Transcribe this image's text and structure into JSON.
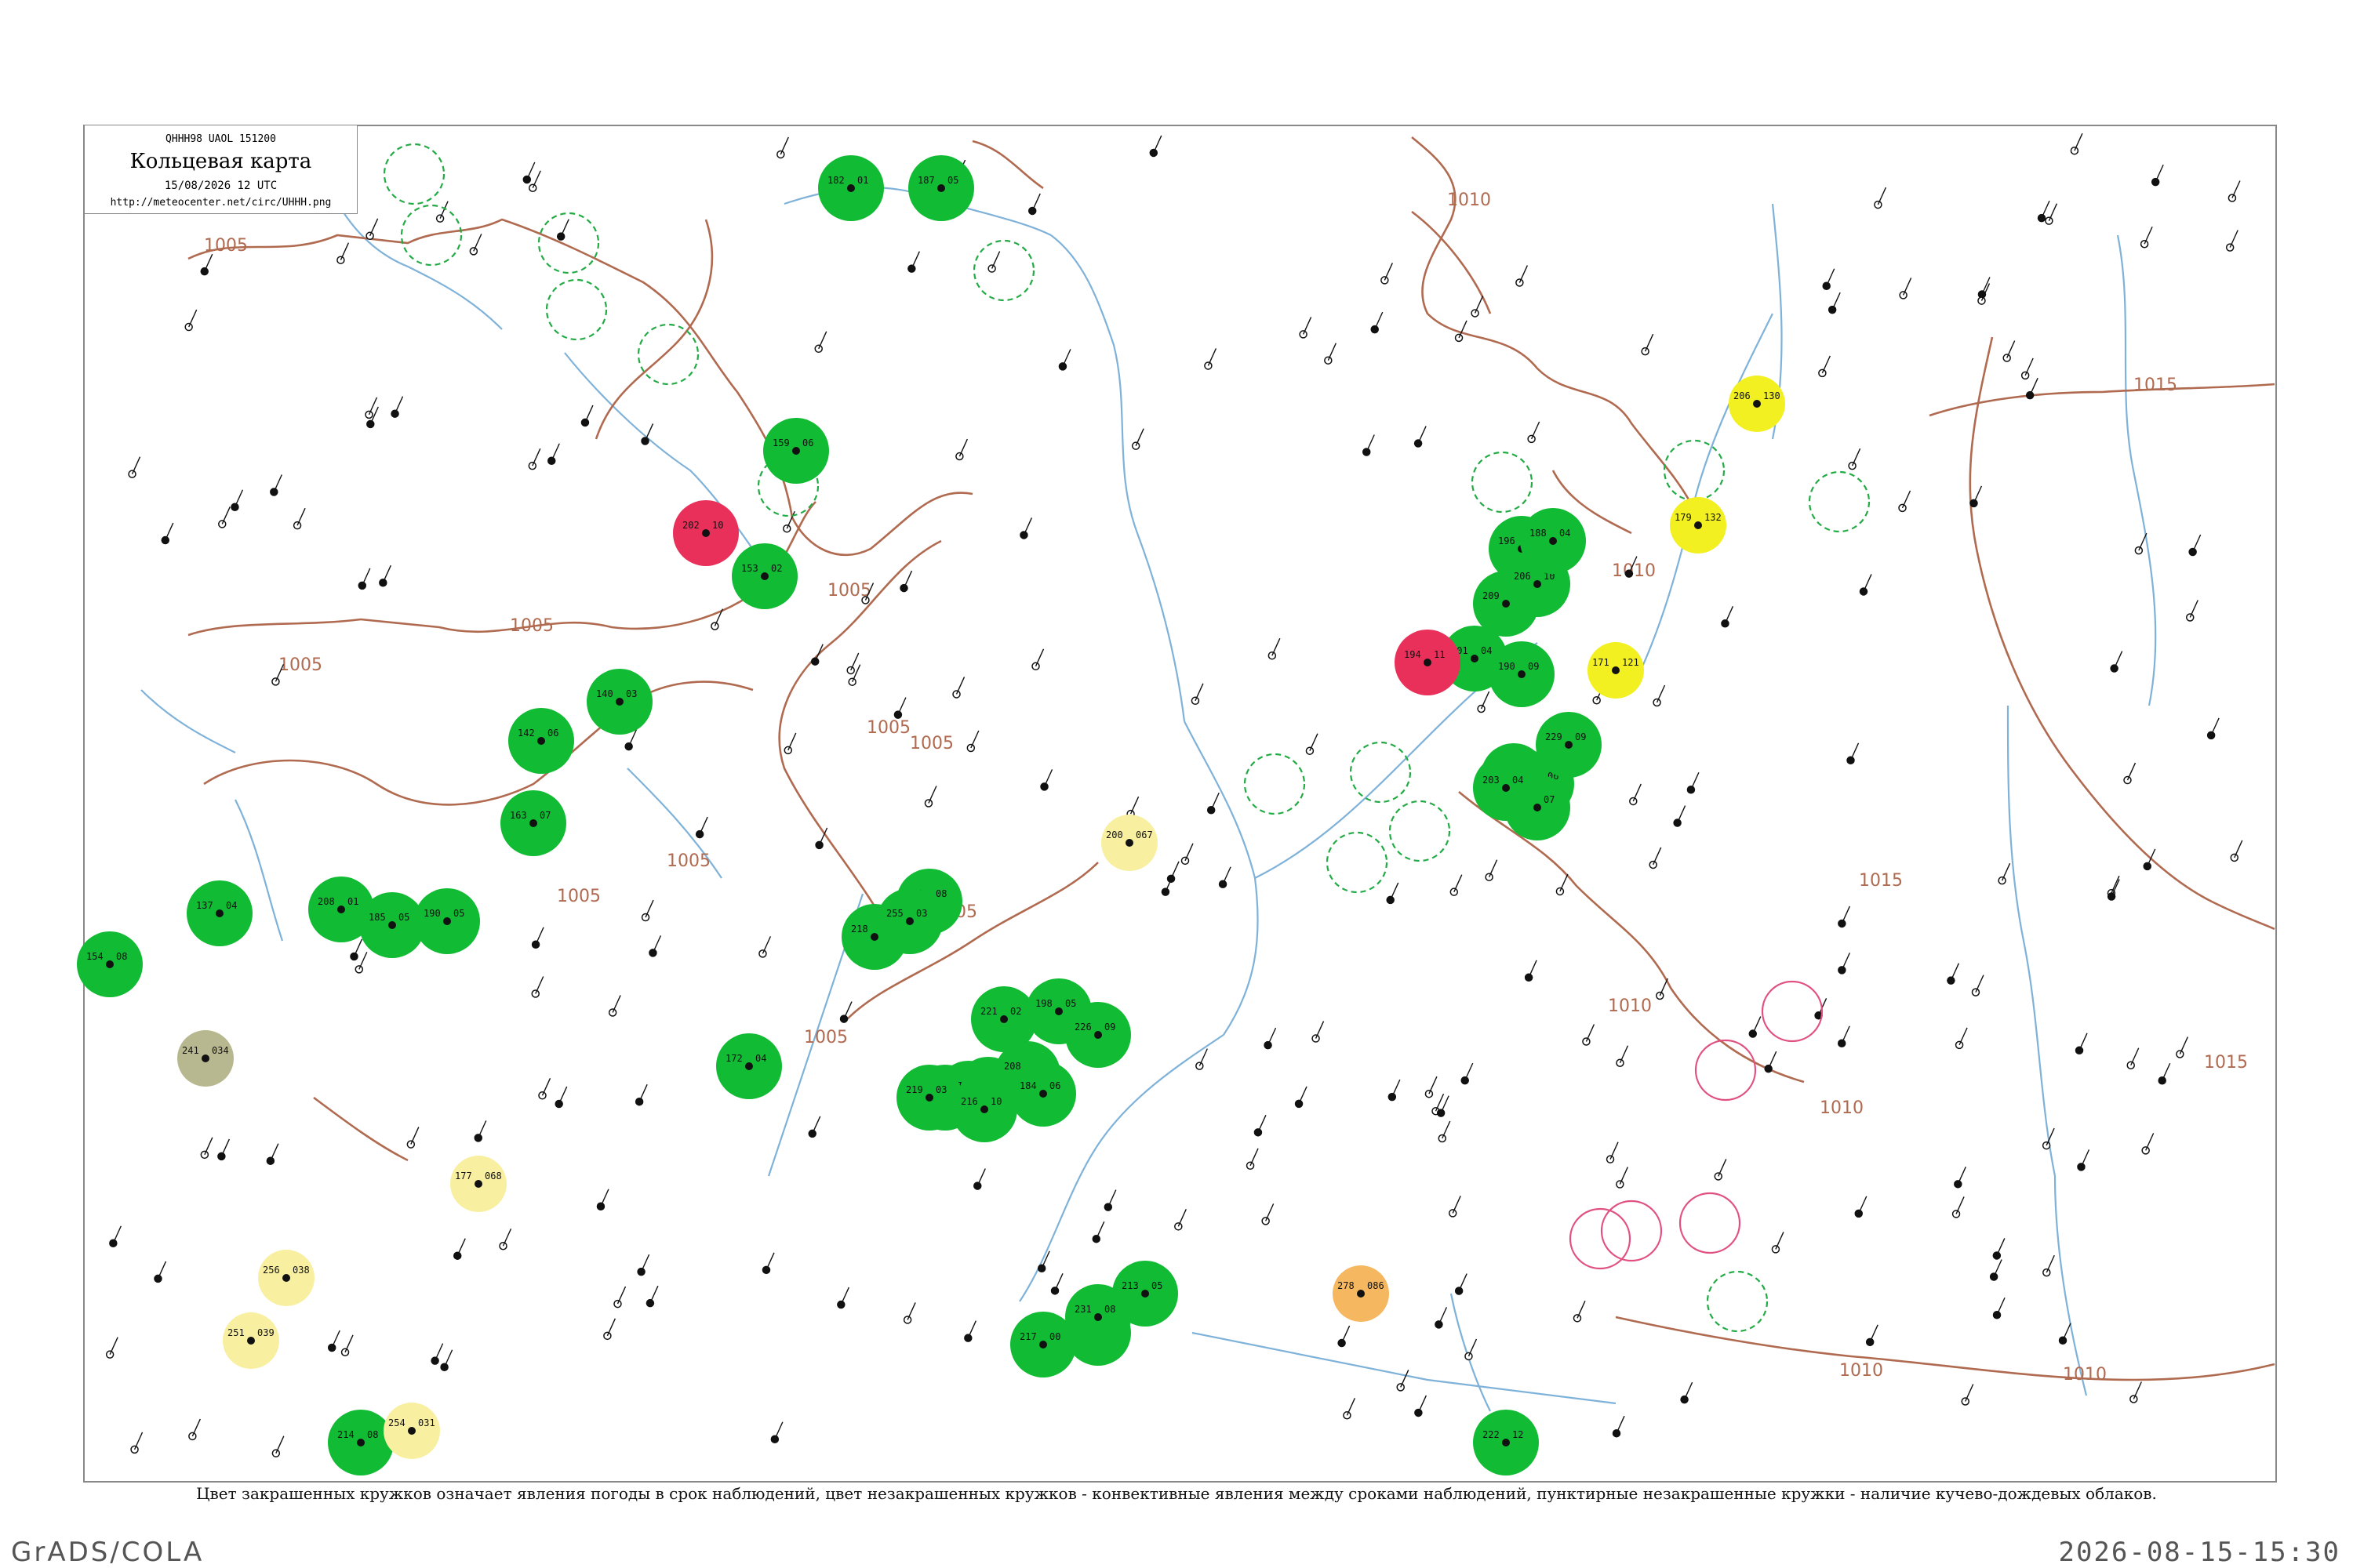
{
  "header": {
    "code": "QHHH98  UAOL  151200",
    "title": "Кольцевая карта",
    "date": "15/08/2026 12 UTC",
    "url": "http://meteocenter.net/circ/UHHH.png"
  },
  "caption": "Цвет закрашенных кружков означает явления погоды в срок наблюдений, цвет незакрашенных кружков - конвективные явления между сроками наблюдений, пунктирные незакрашенные кружки - наличие кучево-дождевых облаков.",
  "footer": {
    "left": "GrADS/COLA",
    "right": "2026-08-15-15:30"
  },
  "colors": {
    "isobar": "#b06a50",
    "river": "#7fb2d9",
    "rain": "#11bb33",
    "thunder": "#e8305a",
    "fog": "#f2f020",
    "haze": "#f8f0a0",
    "dust": "#b8b890",
    "smoke": "#f5b860",
    "cb_ring": "#22aa44",
    "storm_ring": "#e05080"
  },
  "isobar_labels": [
    {
      "text": "1005"
    },
    {
      "text": "1005"
    },
    {
      "text": "1005"
    },
    {
      "text": "1005"
    },
    {
      "text": "1005"
    },
    {
      "text": "1005"
    },
    {
      "text": "1005"
    },
    {
      "text": "1005"
    },
    {
      "text": "1005"
    },
    {
      "text": "1005"
    },
    {
      "text": "1010"
    },
    {
      "text": "1010"
    },
    {
      "text": "1010"
    },
    {
      "text": "1010"
    },
    {
      "text": "1010"
    },
    {
      "text": "1015"
    },
    {
      "text": "1015"
    },
    {
      "text": "1015"
    },
    {
      "text": "1010"
    }
  ],
  "stations": [
    {
      "kind": "rain",
      "t": "182",
      "p": "01"
    },
    {
      "kind": "rain",
      "t": "187",
      "p": "05"
    },
    {
      "kind": "rain",
      "t": "159",
      "p": "06"
    },
    {
      "kind": "rain",
      "t": "153",
      "p": "02"
    },
    {
      "kind": "rain",
      "t": "142",
      "p": "06"
    },
    {
      "kind": "rain",
      "t": "140",
      "p": "03"
    },
    {
      "kind": "rain",
      "t": "154",
      "p": "08"
    },
    {
      "kind": "rain",
      "t": "137",
      "p": "04"
    },
    {
      "kind": "rain",
      "t": "208",
      "p": "01"
    },
    {
      "kind": "rain",
      "t": "185",
      "p": "05"
    },
    {
      "kind": "rain",
      "t": "190",
      "p": "05"
    },
    {
      "kind": "rain",
      "t": "163",
      "p": "07"
    },
    {
      "kind": "rain",
      "t": "218",
      "p": "13"
    },
    {
      "kind": "rain",
      "t": "181",
      "p": "08"
    },
    {
      "kind": "rain",
      "t": "172",
      "p": "04"
    },
    {
      "kind": "rain",
      "t": "223",
      "p": "09"
    },
    {
      "kind": "rain",
      "t": "196",
      "p": "01"
    },
    {
      "kind": "rain",
      "t": "221",
      "p": "02"
    },
    {
      "kind": "rain",
      "t": "198",
      "p": "05"
    },
    {
      "kind": "rain",
      "t": "226",
      "p": "09"
    },
    {
      "kind": "rain",
      "t": "208",
      "p": "08"
    },
    {
      "kind": "rain",
      "t": "237",
      "p": "04"
    },
    {
      "kind": "rain",
      "t": "216",
      "p": "09"
    },
    {
      "kind": "rain",
      "t": "213",
      "p": "05"
    },
    {
      "kind": "rain",
      "t": "217",
      "p": "00"
    },
    {
      "kind": "rain",
      "t": "231",
      "p": "08"
    },
    {
      "kind": "rain",
      "t": "222",
      "p": "12"
    },
    {
      "kind": "rain",
      "t": "201",
      "p": "04"
    },
    {
      "kind": "rain",
      "t": "190",
      "p": "09"
    },
    {
      "kind": "rain",
      "t": "209",
      "p": "13"
    },
    {
      "kind": "rain",
      "t": "196",
      "p": "05"
    },
    {
      "kind": "rain",
      "t": "206",
      "p": "10"
    },
    {
      "kind": "rain",
      "t": "188",
      "p": "04"
    },
    {
      "kind": "rain",
      "t": "190",
      "p": "08"
    },
    {
      "kind": "rain",
      "t": "210",
      "p": "05"
    },
    {
      "kind": "rain",
      "t": "211",
      "p": "06"
    },
    {
      "kind": "rain",
      "t": "195",
      "p": "07"
    },
    {
      "kind": "rain",
      "t": "229",
      "p": "09"
    },
    {
      "kind": "rain",
      "t": "203",
      "p": "04"
    },
    {
      "kind": "rain",
      "t": "214",
      "p": "08"
    },
    {
      "kind": "rain",
      "t": "219",
      "p": "03"
    },
    {
      "kind": "rain",
      "t": "216",
      "p": "10"
    },
    {
      "kind": "rain",
      "t": "184",
      "p": "06"
    },
    {
      "kind": "rain",
      "t": "255",
      "p": "03"
    },
    {
      "kind": "thunder",
      "t": "202",
      "p": "10"
    },
    {
      "kind": "thunder",
      "t": "194",
      "p": "11"
    },
    {
      "kind": "fog",
      "t": "206",
      "p": "130"
    },
    {
      "kind": "fog",
      "t": "179",
      "p": "132"
    },
    {
      "kind": "fog",
      "t": "171",
      "p": "121"
    },
    {
      "kind": "haze",
      "t": "200",
      "p": "067"
    },
    {
      "kind": "haze",
      "t": "177",
      "p": "068"
    },
    {
      "kind": "haze",
      "t": "256",
      "p": "038"
    },
    {
      "kind": "haze",
      "t": "251",
      "p": "039"
    },
    {
      "kind": "haze",
      "t": "254",
      "p": "031"
    },
    {
      "kind": "dust",
      "t": "241",
      "p": "034"
    },
    {
      "kind": "smoke",
      "t": "278",
      "p": "086"
    }
  ],
  "rings": [
    {
      "kind": "cb"
    },
    {
      "kind": "cb"
    },
    {
      "kind": "cb"
    },
    {
      "kind": "cb"
    },
    {
      "kind": "cb"
    },
    {
      "kind": "cb"
    },
    {
      "kind": "cb"
    },
    {
      "kind": "cb"
    },
    {
      "kind": "cb"
    },
    {
      "kind": "cb"
    },
    {
      "kind": "cb"
    },
    {
      "kind": "cb"
    },
    {
      "kind": "cb"
    },
    {
      "kind": "cb"
    },
    {
      "kind": "cb"
    },
    {
      "kind": "storm"
    },
    {
      "kind": "storm"
    },
    {
      "kind": "storm"
    },
    {
      "kind": "storm"
    },
    {
      "kind": "storm"
    }
  ]
}
